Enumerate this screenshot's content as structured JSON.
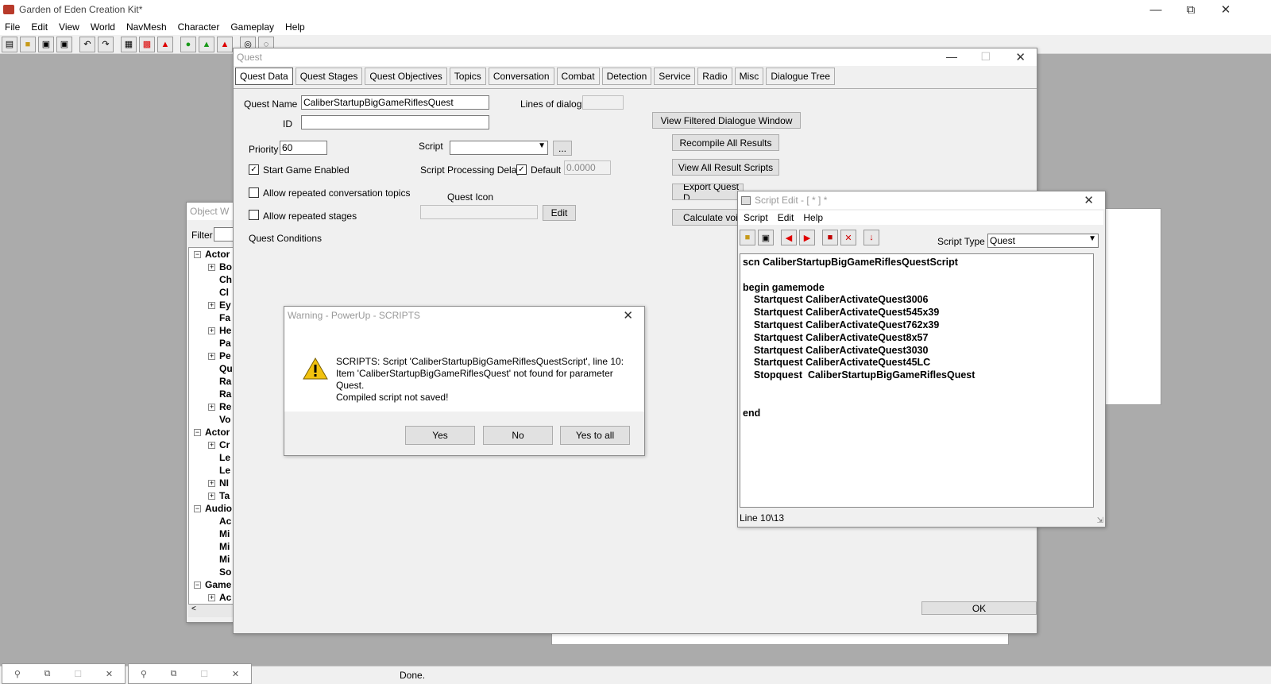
{
  "app": {
    "title": "Garden of Eden Creation Kit*",
    "menu": [
      "File",
      "Edit",
      "View",
      "World",
      "NavMesh",
      "Character",
      "Gameplay",
      "Help"
    ]
  },
  "toolbar_icons": [
    "new-icon",
    "open-icon",
    "save-icon",
    "save-as-icon",
    "undo-icon",
    "redo-icon",
    "grid-icon",
    "snap-icon",
    "angle-icon",
    "sphere-icon",
    "landscape-icon",
    "nav-icon",
    "zoom-icon",
    "render-icon"
  ],
  "quest": {
    "title": "Quest",
    "tabs": [
      "Quest Data",
      "Quest Stages",
      "Quest Objectives",
      "Topics",
      "Conversation",
      "Combat",
      "Detection",
      "Service",
      "Radio",
      "Misc",
      "Dialogue Tree"
    ],
    "quest_name_label": "Quest Name",
    "quest_name": "CaliberStartupBigGameRiflesQuest",
    "lines_label": "Lines of dialog:",
    "id_label": "ID",
    "id_value": "",
    "priority_label": "Priority",
    "priority": "60",
    "script_label": "Script",
    "script_value": "",
    "browse_label": "...",
    "start_enabled_label": "Start Game Enabled",
    "start_enabled": true,
    "delay_label": "Script Processing Delay",
    "default_label": "Default",
    "delay_value": "0.0000",
    "allow_topics_label": "Allow repeated conversation topics",
    "allow_stages_label": "Allow repeated stages",
    "quest_icon_label": "Quest Icon",
    "edit_label": "Edit",
    "conditions_label": "Quest Conditions",
    "buttons": {
      "filtered": "View Filtered Dialogue Window",
      "recompile": "Recompile All Results",
      "view_scripts": "View All Result Scripts",
      "export": "Export Quest D",
      "calculate": "Calculate voic"
    },
    "ok_label": "OK"
  },
  "object_window": {
    "title": "Object W",
    "filter_label": "Filter",
    "tree": [
      {
        "label": "Actor",
        "expanded": true,
        "children": [
          "Bo",
          "Ch",
          "Cl",
          "Ey",
          "Fa",
          "He",
          "Pa",
          "Pe",
          "Qu",
          "Ra",
          "Ra",
          "Re",
          "Vo"
        ]
      },
      {
        "label": "Actor",
        "expanded": true,
        "children": [
          "Cr",
          "Le",
          "Le",
          "NI",
          "Ta"
        ]
      },
      {
        "label": "Audio",
        "expanded": true,
        "children": [
          "Ac",
          "Mi",
          "Mi",
          "Mi",
          "So"
        ]
      },
      {
        "label": "Game",
        "expanded": true,
        "children": [
          "Ac"
        ]
      }
    ]
  },
  "warning": {
    "title": "Warning - PowerUp - SCRIPTS",
    "line1": "SCRIPTS: Script 'CaliberStartupBigGameRiflesQuestScript', line 10:",
    "line2": "Item 'CaliberStartupBigGameRiflesQuest' not found for parameter",
    "line3": "Quest.",
    "line4": "Compiled script not saved!",
    "yes": "Yes",
    "no": "No",
    "yes_all": "Yes to all"
  },
  "script_edit": {
    "title": "Script Edit - [ * ] *",
    "menu": [
      "Script",
      "Edit",
      "Help"
    ],
    "type_label": "Script Type",
    "type_value": "Quest",
    "code": "scn CaliberStartupBigGameRiflesQuestScript\n\nbegin gamemode\n    Startquest CaliberActivateQuest3006\n    Startquest CaliberActivateQuest545x39\n    Startquest CaliberActivateQuest762x39\n    Startquest CaliberActivateQuest8x57\n    Startquest CaliberActivateQuest3030\n    Startquest CaliberActivateQuest45LC\n    Stopquest  CaliberStartupBigGameRiflesQuest\n\n\nend",
    "status": "Line 10\\13"
  },
  "status_text": "Done."
}
